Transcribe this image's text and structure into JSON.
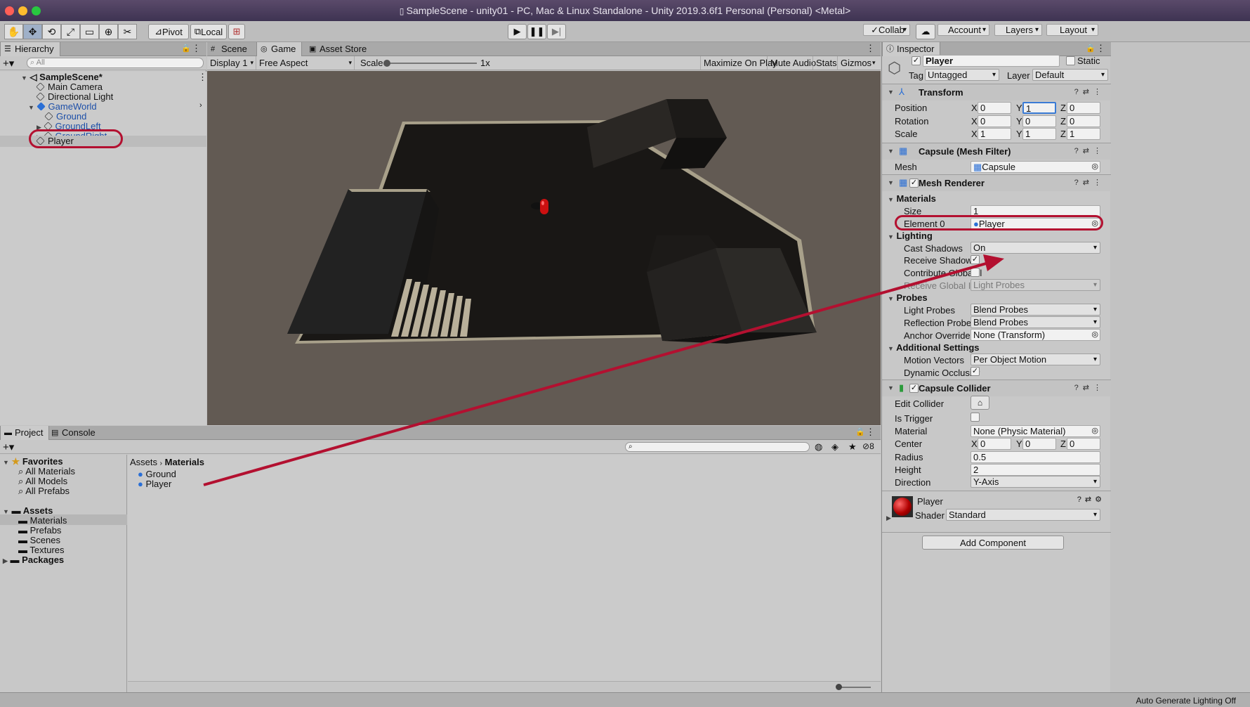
{
  "window": {
    "title": "SampleScene - unity01 - PC, Mac & Linux Standalone - Unity 2019.3.6f1 Personal (Personal) <Metal>"
  },
  "toolbar": {
    "pivot": "Pivot",
    "local": "Local",
    "collab": "Collab",
    "account": "Account",
    "layers": "Layers",
    "layout": "Layout"
  },
  "hierarchy": {
    "tab": "Hierarchy",
    "search_placeholder": "All",
    "scene": "SampleScene*",
    "items": [
      "Main Camera",
      "Directional Light",
      "GameWorld",
      "Ground",
      "GroundLeft",
      "GroundRight",
      "Player"
    ]
  },
  "game": {
    "tabs": [
      "Scene",
      "Game",
      "Asset Store"
    ],
    "display": "Display 1",
    "aspect": "Free Aspect",
    "scale_label": "Scale",
    "scale_value": "1x",
    "maximize": "Maximize On Play",
    "mute": "Mute Audio",
    "stats": "Stats",
    "gizmos": "Gizmos"
  },
  "project": {
    "tabs": [
      "Project",
      "Console"
    ],
    "hidden_count": "8",
    "favorites": "Favorites",
    "fav_items": [
      "All Materials",
      "All Models",
      "All Prefabs"
    ],
    "assets": "Assets",
    "asset_folders": [
      "Materials",
      "Prefabs",
      "Scenes",
      "Textures"
    ],
    "packages": "Packages",
    "breadcrumb": [
      "Assets",
      "Materials"
    ],
    "files": [
      "Ground",
      "Player"
    ]
  },
  "inspector": {
    "tab": "Inspector",
    "name": "Player",
    "static": "Static",
    "tag_label": "Tag",
    "tag": "Untagged",
    "layer_label": "Layer",
    "layer": "Default",
    "transform": {
      "title": "Transform",
      "rows": [
        {
          "label": "Position",
          "x": "0",
          "y": "1",
          "z": "0"
        },
        {
          "label": "Rotation",
          "x": "0",
          "y": "0",
          "z": "0"
        },
        {
          "label": "Scale",
          "x": "1",
          "y": "1",
          "z": "1"
        }
      ]
    },
    "mesh_filter": {
      "title": "Capsule (Mesh Filter)",
      "mesh_label": "Mesh",
      "mesh": "Capsule"
    },
    "mesh_renderer": {
      "title": "Mesh Renderer",
      "materials": "Materials",
      "size_label": "Size",
      "size": "1",
      "element_label": "Element 0",
      "element": "Player",
      "lighting": "Lighting",
      "cast_label": "Cast Shadows",
      "cast": "On",
      "receive_label": "Receive Shadows",
      "contrib_label": "Contribute Global Il",
      "recv_gi_label": "Receive Global Illu",
      "recv_gi": "Light Probes",
      "probes": "Probes",
      "lp_label": "Light Probes",
      "lp": "Blend Probes",
      "rp_label": "Reflection Probes",
      "rp": "Blend Probes",
      "anchor_label": "Anchor Override",
      "anchor": "None (Transform)",
      "additional": "Additional Settings",
      "mv_label": "Motion Vectors",
      "mv": "Per Object Motion",
      "dyn_label": "Dynamic Occlusior"
    },
    "collider": {
      "title": "Capsule Collider",
      "edit_label": "Edit Collider",
      "trigger_label": "Is Trigger",
      "material_label": "Material",
      "material": "None (Physic Material)",
      "center_label": "Center",
      "cx": "0",
      "cy": "0",
      "cz": "0",
      "radius_label": "Radius",
      "radius": "0.5",
      "height_label": "Height",
      "height": "2",
      "direction_label": "Direction",
      "direction": "Y-Axis"
    },
    "material": {
      "name": "Player",
      "shader_label": "Shader",
      "shader": "Standard"
    },
    "add_component": "Add Component"
  },
  "status": {
    "text": "Auto Generate Lighting Off"
  },
  "colors": {
    "highlight": "#b31030",
    "accent": "#2a6fd6"
  }
}
